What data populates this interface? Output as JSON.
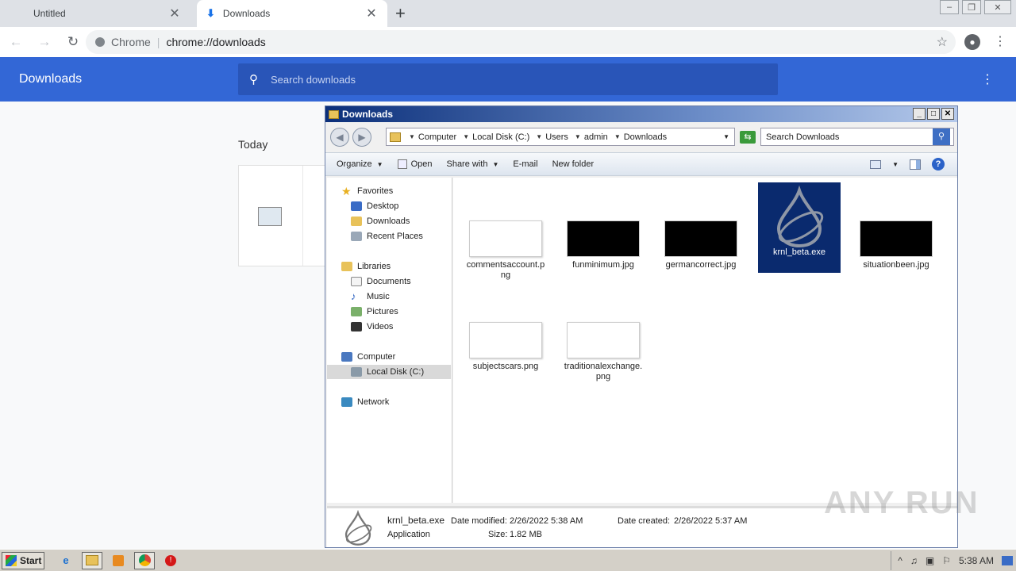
{
  "browser": {
    "tabs": [
      {
        "label": "Untitled"
      },
      {
        "label": "Downloads"
      }
    ],
    "omnibox": {
      "chip": "Chrome",
      "separator": "|",
      "url": "chrome://downloads"
    }
  },
  "downloads_page": {
    "title": "Downloads",
    "search_placeholder": "Search downloads",
    "section_label": "Today"
  },
  "explorer": {
    "title": "Downloads",
    "breadcrumb": [
      "Computer",
      "Local Disk (C:)",
      "Users",
      "admin",
      "Downloads"
    ],
    "search_placeholder": "Search Downloads",
    "commands": {
      "organize": "Organize",
      "open": "Open",
      "share_with": "Share with",
      "email": "E-mail",
      "new_folder": "New folder"
    },
    "nav": {
      "favorites": "Favorites",
      "desktop": "Desktop",
      "downloads": "Downloads",
      "recent_places": "Recent Places",
      "libraries": "Libraries",
      "documents": "Documents",
      "music": "Music",
      "pictures": "Pictures",
      "videos": "Videos",
      "computer": "Computer",
      "local_disk": "Local Disk (C:)",
      "network": "Network"
    },
    "files": [
      {
        "name": "commentsaccount.png"
      },
      {
        "name": "funminimum.jpg"
      },
      {
        "name": "germancorrect.jpg"
      },
      {
        "name": "krnl_beta.exe"
      },
      {
        "name": "situationbeen.jpg"
      },
      {
        "name": "subjectscars.png"
      },
      {
        "name": "traditionalexchange.png"
      }
    ],
    "status": {
      "filename": "krnl_beta.exe",
      "type": "Application",
      "date_modified_label": "Date modified:",
      "date_modified": "2/26/2022 5:38 AM",
      "size_label": "Size:",
      "size": "1.82 MB",
      "date_created_label": "Date created:",
      "date_created": "2/26/2022 5:37 AM"
    }
  },
  "taskbar": {
    "start_label": "Start",
    "clock": "5:38 AM"
  },
  "watermark": "ANY RUN",
  "colors": {
    "chrome_header": "#3367d6",
    "selection": "#0a2a6e"
  }
}
